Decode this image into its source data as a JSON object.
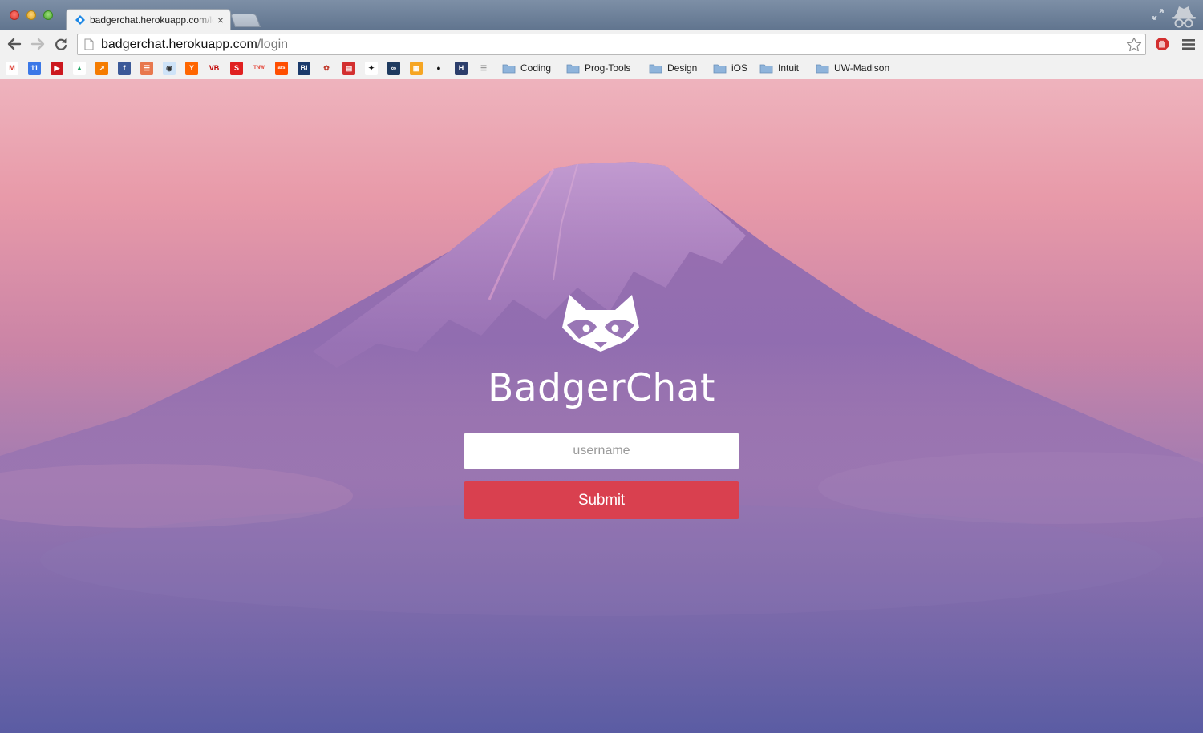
{
  "browser": {
    "tab": {
      "title": "badgerchat.herokuapp.com/login",
      "close_glyph": "×"
    },
    "omnibox": {
      "host": "badgerchat.herokuapp.com",
      "path": "/login"
    },
    "bookmarks": {
      "icons": [
        {
          "name": "gmail-icon",
          "glyph": "M",
          "color": "#ffffff",
          "text": "#d93025"
        },
        {
          "name": "calendar-icon",
          "glyph": "11",
          "color": "#3b78e7",
          "text": "#ffffff"
        },
        {
          "name": "youtube-icon",
          "glyph": "▶",
          "color": "#cc181e",
          "text": "#ffffff"
        },
        {
          "name": "drive-icon",
          "glyph": "▲",
          "color": "#ffffff",
          "text": "#1fa463"
        },
        {
          "name": "analytics-icon",
          "glyph": "↗",
          "color": "#f57c00",
          "text": "#ffffff"
        },
        {
          "name": "facebook-icon",
          "glyph": "f",
          "color": "#3b5998",
          "text": "#ffffff"
        },
        {
          "name": "feedly-icon",
          "glyph": "☰",
          "color": "#e8784d",
          "text": "#ffffff"
        },
        {
          "name": "reddit-icon",
          "glyph": "◉",
          "color": "#cee3f8",
          "text": "#333333"
        },
        {
          "name": "hackernews-icon",
          "glyph": "Y",
          "color": "#ff6600",
          "text": "#ffffff"
        },
        {
          "name": "venturebeat-icon",
          "glyph": "VB",
          "color": "#f1f1f1",
          "text": "#c00000"
        },
        {
          "name": "swiss-icon",
          "glyph": "S",
          "color": "#e02020",
          "text": "#ffffff"
        },
        {
          "name": "tnw-icon",
          "glyph": "TNW",
          "color": "#f1f1f1",
          "text": "#e23b2e"
        },
        {
          "name": "ars-icon",
          "glyph": "ars",
          "color": "#ff4e00",
          "text": "#ffffff"
        },
        {
          "name": "businessinsider-icon",
          "glyph": "BI",
          "color": "#1b3a6b",
          "text": "#ffffff"
        },
        {
          "name": "comic-icon",
          "glyph": "✿",
          "color": "#f1f1f1",
          "text": "#c0392b"
        },
        {
          "name": "news-icon",
          "glyph": "▤",
          "color": "#d32f2f",
          "text": "#ffffff"
        },
        {
          "name": "xkcd-icon",
          "glyph": "✦",
          "color": "#ffffff",
          "text": "#111111"
        },
        {
          "name": "link-icon",
          "glyph": "∞",
          "color": "#1e3a5f",
          "text": "#ffffff"
        },
        {
          "name": "grid-icon",
          "glyph": "▦",
          "color": "#f6a623",
          "text": "#ffffff"
        },
        {
          "name": "github-icon",
          "glyph": "●",
          "color": "#f1f1f1",
          "text": "#111111"
        },
        {
          "name": "h-icon",
          "glyph": "H",
          "color": "#2c3e6b",
          "text": "#ffffff"
        },
        {
          "name": "more-bookmarks-icon",
          "glyph": "☰",
          "color": "#f1f1f1",
          "text": "#999999"
        }
      ],
      "folders": [
        "Coding",
        "Prog-Tools",
        "Design",
        "iOS",
        "Intuit",
        "UW-Madison"
      ]
    }
  },
  "login": {
    "brand": "BadgerChat",
    "username_placeholder": "username",
    "username_value": "",
    "submit_label": "Submit",
    "colors": {
      "submit": "#d9404f",
      "text": "#ffffff"
    }
  }
}
